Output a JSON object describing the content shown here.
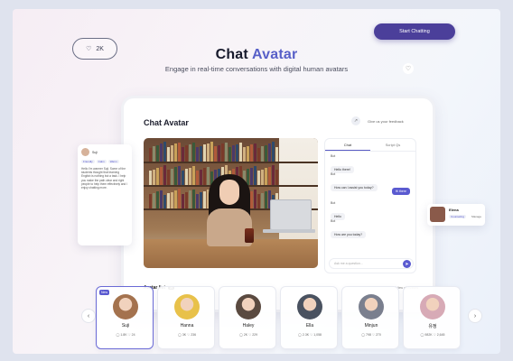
{
  "hero": {
    "title_main": "Chat ",
    "title_accent": "Avatar",
    "subtitle": "Engage in real-time conversations with digital human avatars",
    "like_count": "2K",
    "start_button": "Start Chatting"
  },
  "app": {
    "title": "Chat Avatar",
    "feedback": "Give us your feedback",
    "chat_tabs": [
      "Chat",
      "Script Qs"
    ],
    "messages": [
      {
        "from": "bot",
        "label": "Bot",
        "text": "Hello there!"
      },
      {
        "from": "bot",
        "label": "Bot",
        "text": "How can I assist you today?"
      },
      {
        "from": "me",
        "label": "",
        "text": "Hi there"
      },
      {
        "from": "bot",
        "label": "Bot",
        "text": "Hello"
      },
      {
        "from": "bot",
        "label": "Bot",
        "text": "How are you today?"
      }
    ],
    "input_placeholder": "Ask me a question...",
    "avatar_list_label": "Avatar list",
    "avatar_list_count": "24",
    "view_all": "View all avatars"
  },
  "left_card": {
    "name": "Suji",
    "tags": [
      "Friendly",
      "Calm",
      "Warm"
    ],
    "text": "Hello I'm warmer Suji. Some of the students thought that learning English is nothing but a task. I help you make the path clear and right people to help them effectively and I enjoy chatting more."
  },
  "right_card": {
    "name": "Elena",
    "tag": "Counseling",
    "manage": "Manage"
  },
  "carousel": {
    "prev_icon": "‹",
    "next_icon": "›",
    "new_label": "New",
    "cards": [
      {
        "name": "Suji",
        "chats": "1.8K",
        "likes": "24",
        "color": "#a4724e"
      },
      {
        "name": "Hanna",
        "chats": "3K",
        "likes": "236",
        "color": "#e8c14a"
      },
      {
        "name": "Haley",
        "chats": "2K",
        "likes": "229",
        "color": "#5a4a40"
      },
      {
        "name": "Ella",
        "chats": "2.3K",
        "likes": "1,058",
        "color": "#4a5260"
      },
      {
        "name": "Minjun",
        "chats": "798",
        "likes": "270",
        "color": "#7a7f8e"
      },
      {
        "name": "유정",
        "chats": "982K",
        "likes": "2,645",
        "color": "#d7aab6"
      }
    ]
  }
}
